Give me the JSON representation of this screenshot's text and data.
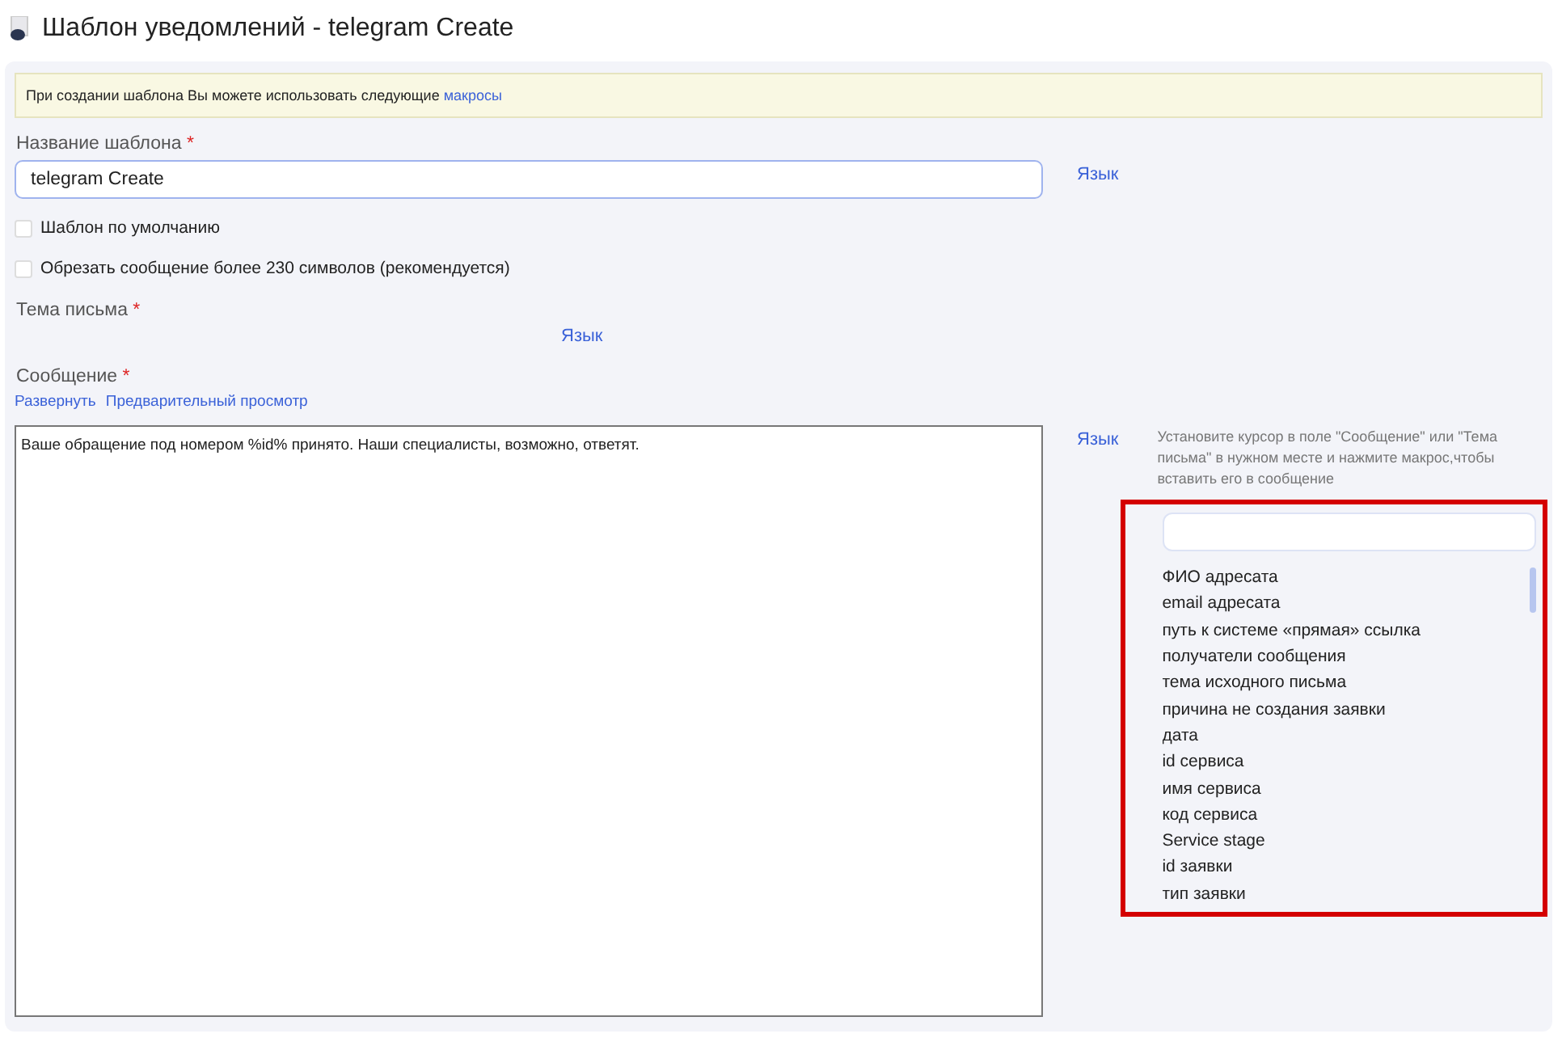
{
  "window": {
    "title": "Шаблон уведомлений - telegram Create"
  },
  "notice": {
    "text": "При создании шаблона Вы можете использовать следующие ",
    "link": "макросы"
  },
  "name_field": {
    "label": "Название шаблона",
    "required_mark": "*",
    "value": "telegram Create",
    "lang_link": "Язык"
  },
  "checkboxes": [
    {
      "label": "Шаблон по умолчанию",
      "checked": false
    },
    {
      "label": "Обрезать сообщение более 230 символов (рекомендуется)",
      "checked": false
    }
  ],
  "subject_field": {
    "label": "Тема письма",
    "required_mark": "*",
    "lang_link": "Язык"
  },
  "message_field": {
    "label": "Сообщение",
    "required_mark": "*",
    "links": [
      "Развернуть",
      "Предварительный просмотр"
    ],
    "value": "Ваше обращение под номером %id% принято. Наши специалисты, возможно, ответят.",
    "lang_link": "Язык"
  },
  "macros": {
    "hint": "Установите курсор в поле \"Сообщение\" или \"Тема письма\" в нужном месте и нажмите макрос,чтобы вставить его в сообщение",
    "highlighted": true,
    "items": [
      "ФИО адресата",
      "email адресата",
      "путь к системе «прямая» ссылка",
      "получатели сообщения",
      "тема исходного письма",
      "причина не создания заявки",
      "дата",
      "id сервиса",
      "имя сервиса",
      "код сервиса",
      "Service stage",
      "id заявки",
      "тип заявки"
    ]
  }
}
